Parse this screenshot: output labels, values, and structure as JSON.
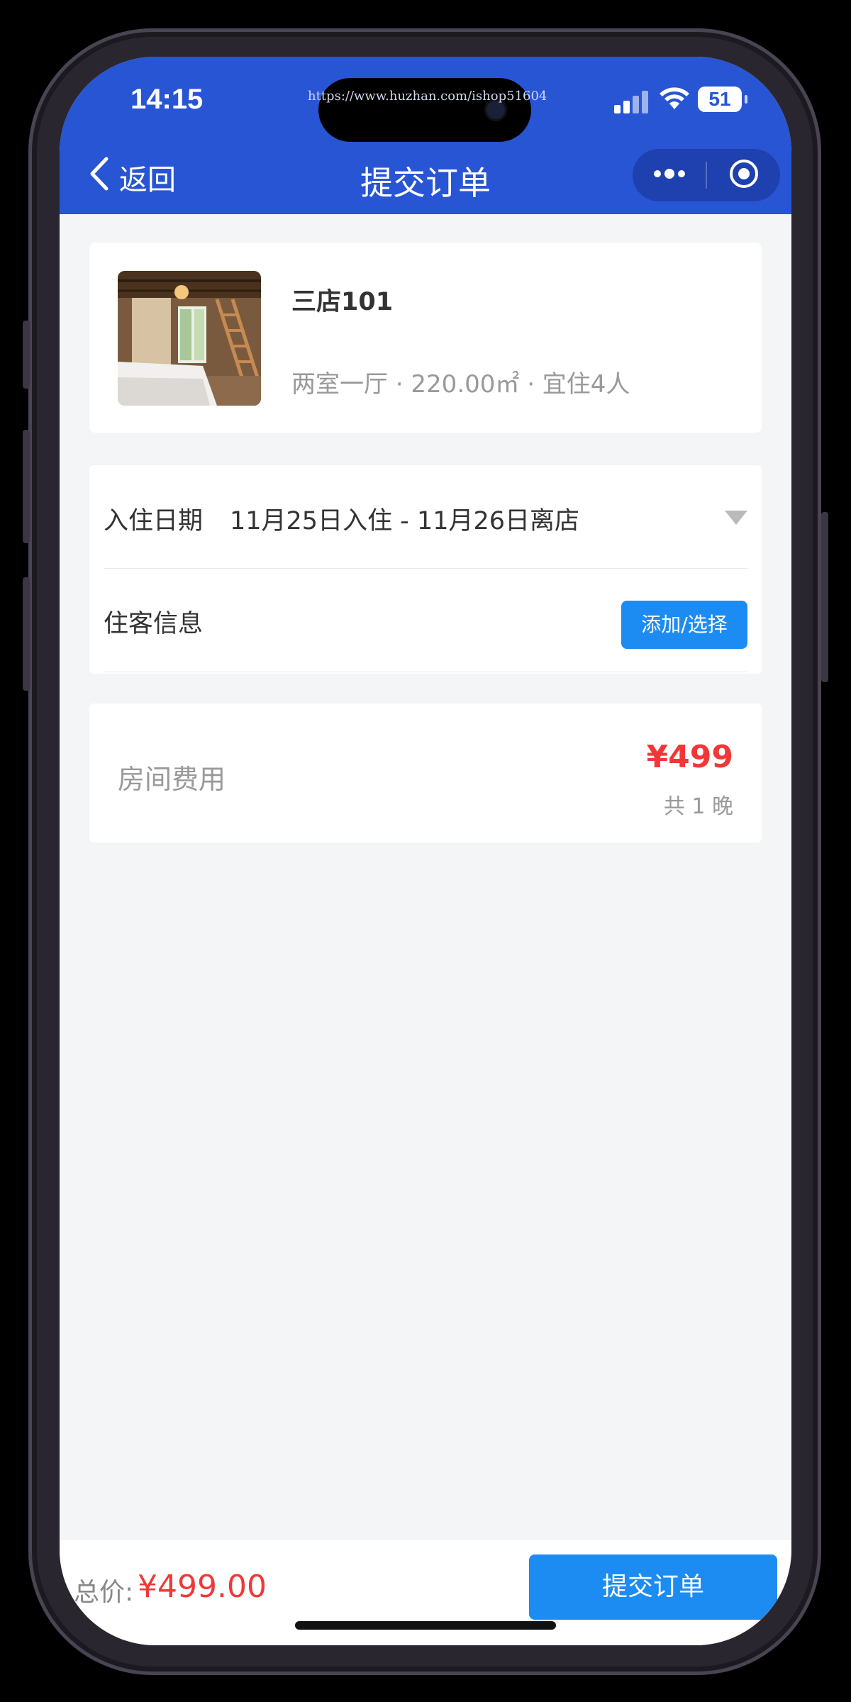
{
  "status_bar": {
    "time": "14:15",
    "battery": "51",
    "watermark": "https://www.huzhan.com/ishop51604"
  },
  "nav": {
    "back_label": "返回",
    "title": "提交订单"
  },
  "room": {
    "name": "三店101",
    "description": "两室一厅 · 220.00㎡ · 宜住4人"
  },
  "stay": {
    "date_label": "入住日期",
    "date_value": "11月25日入住 - 11月26日离店",
    "guest_label": "住客信息",
    "guest_button": "添加/选择"
  },
  "fee": {
    "label": "房间费用",
    "price": "¥499",
    "nights": "共 1 晚"
  },
  "footer": {
    "total_label": "总价:",
    "total_amount": "¥499.00",
    "submit_label": "提交订单"
  },
  "colors": {
    "header_blue": "#2855d3",
    "button_blue": "#1d8cf2",
    "price_red": "#f03838",
    "background": "#f4f5f7"
  },
  "icons": [
    "chevron-left-icon",
    "more-dots-icon",
    "target-circle-icon",
    "dropdown-triangle-icon",
    "wifi-icon",
    "signal-icon",
    "battery-icon"
  ]
}
